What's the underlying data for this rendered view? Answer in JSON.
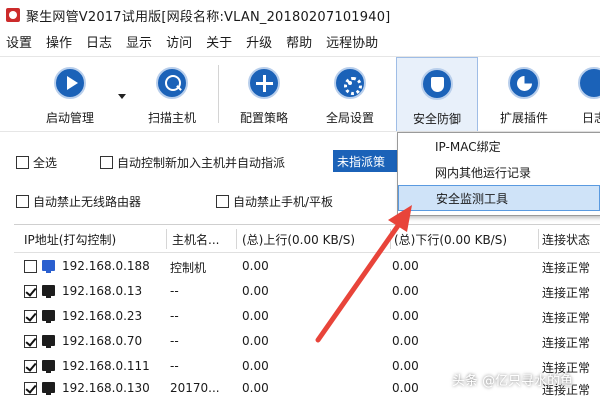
{
  "window": {
    "title": "聚生网管V2017试用版[网段名称:VLAN_20180207101940]"
  },
  "menu": [
    "设置",
    "操作",
    "日志",
    "显示",
    "访问",
    "关于",
    "升级",
    "帮助",
    "远程协助"
  ],
  "toolbar": [
    {
      "label": "启动管理",
      "icon": "play-icon"
    },
    {
      "label": "扫描主机",
      "icon": "magnifier-icon"
    },
    {
      "label": "配置策略",
      "icon": "cross-icon"
    },
    {
      "label": "全局设置",
      "icon": "gear-icon"
    },
    {
      "label": "安全防御",
      "icon": "shield-icon"
    },
    {
      "label": "扩展插件",
      "icon": "pie-icon"
    },
    {
      "label": "日志",
      "icon": "log-icon"
    }
  ],
  "options": {
    "select_all": "全选",
    "auto_control": "自动控制新加入主机并自动指派",
    "unassigned": "未指派策",
    "auto_block_router": "自动禁止无线路由器",
    "auto_block_phone": "自动禁止手机/平板"
  },
  "dropdown": [
    "IP-MAC绑定",
    "网内其他运行记录",
    "安全监测工具"
  ],
  "table": {
    "columns": [
      "IP地址(打勾控制)",
      "主机名...",
      "(总)上行(0.00 KB/S)",
      "(总)下行(0.00 KB/S)",
      "连接状态"
    ],
    "rows": [
      {
        "checked": false,
        "ip": "192.168.0.188",
        "host": "控制机",
        "up": "0.00",
        "down": "0.00",
        "status": "连接正常",
        "icon_color": "blue"
      },
      {
        "checked": true,
        "ip": "192.168.0.13",
        "host": "--",
        "up": "0.00",
        "down": "0.00",
        "status": "连接正常",
        "icon_color": "black"
      },
      {
        "checked": true,
        "ip": "192.168.0.23",
        "host": "--",
        "up": "0.00",
        "down": "0.00",
        "status": "连接正常",
        "icon_color": "black"
      },
      {
        "checked": true,
        "ip": "192.168.0.70",
        "host": "--",
        "up": "0.00",
        "down": "0.00",
        "status": "连接正常",
        "icon_color": "black"
      },
      {
        "checked": true,
        "ip": "192.168.0.111",
        "host": "--",
        "up": "0.00",
        "down": "0.00",
        "status": "连接正常",
        "icon_color": "black"
      },
      {
        "checked": true,
        "ip": "192.168.0.130",
        "host": "20170...",
        "up": "0.00",
        "down": "0.00",
        "status": "连接正常",
        "icon_color": "black"
      }
    ]
  },
  "watermark": "头条 @亿只寻水的鱼",
  "colors": {
    "accent": "#1b62b8",
    "arrow": "#e8443a",
    "highlight": "#cfe3f8"
  }
}
